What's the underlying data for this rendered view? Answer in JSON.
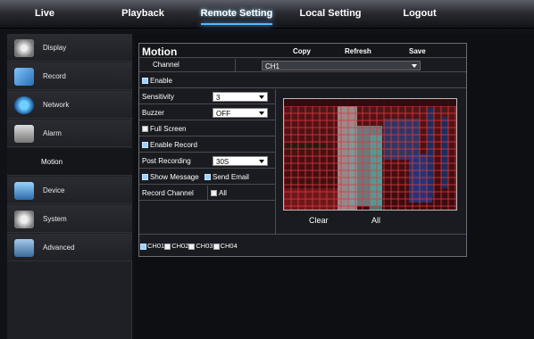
{
  "topbar": {
    "tabs": [
      "Live",
      "Playback",
      "Remote Setting",
      "Local Setting",
      "Logout"
    ]
  },
  "sidebar": {
    "items": [
      "Display",
      "Record",
      "Network",
      "Alarm",
      "Motion",
      "Device",
      "System",
      "Advanced"
    ]
  },
  "motion": {
    "title": "Motion",
    "copy": "Copy",
    "refresh": "Refresh",
    "save": "Save",
    "channel_label": "Channel",
    "channel_value": "CH1",
    "enable": "Enable",
    "sensitivity_label": "Sensitivity",
    "sensitivity_value": "3",
    "buzzer_label": "Buzzer",
    "buzzer_value": "OFF",
    "full_screen": "Full Screen",
    "enable_record": "Enable Record",
    "post_recording_label": "Post Recording",
    "post_recording_value": "30S",
    "show_message": "Show Message",
    "send_email": "Send Email",
    "record_channel_label": "Record Channel",
    "all_check": "All",
    "clear": "Clear",
    "all_button": "All",
    "channels": [
      "CH01",
      "CH02",
      "CH03",
      "CH04"
    ]
  },
  "colors": {
    "accent": "#59b7ff",
    "grid_red": "#c0202a"
  }
}
